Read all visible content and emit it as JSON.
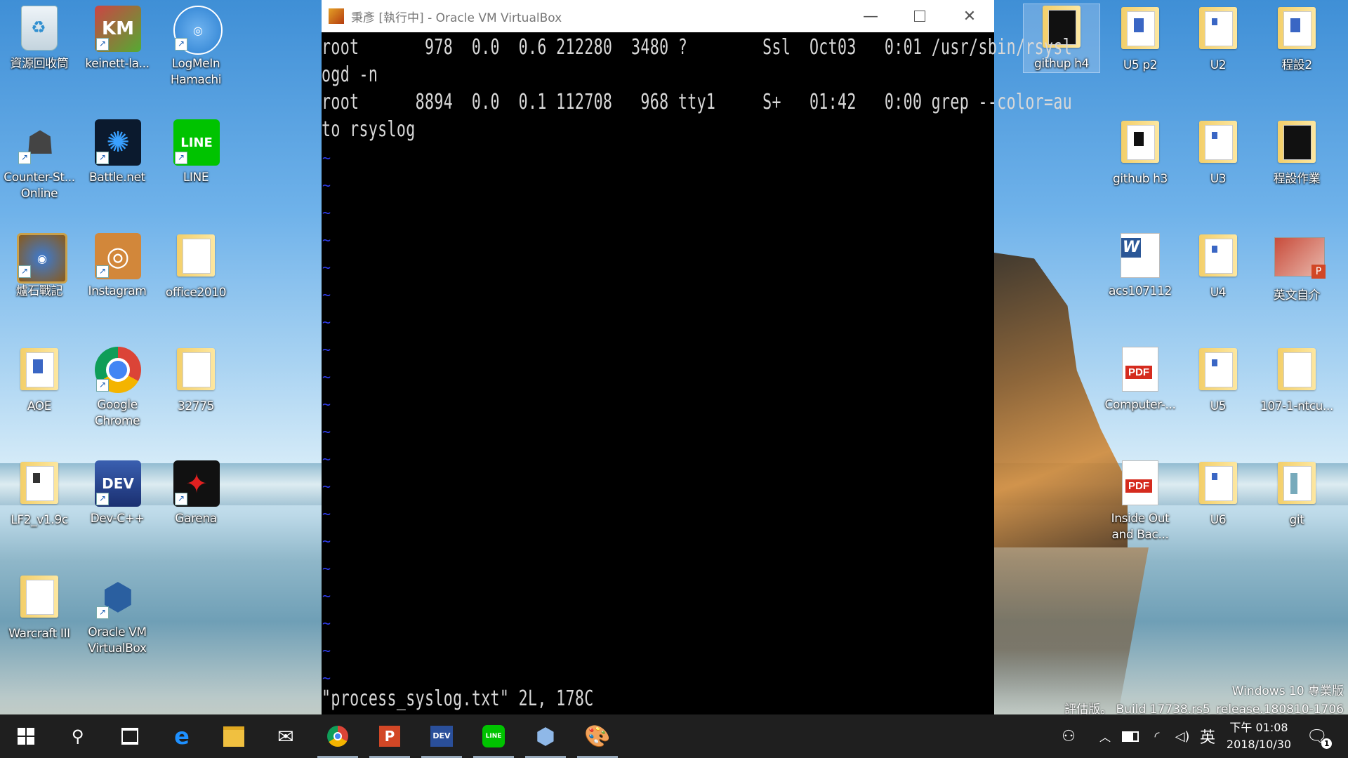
{
  "desktop_icons": [
    {
      "label": "資源回收筒"
    },
    {
      "label": "keinett-la..."
    },
    {
      "label": "LogMeIn Hamachi"
    },
    {
      "label": "Counter-St... Online"
    },
    {
      "label": "Battle.net"
    },
    {
      "label": "LINE"
    },
    {
      "label": "爐石戰記"
    },
    {
      "label": "Instagram"
    },
    {
      "label": "office2010"
    },
    {
      "label": "AOE"
    },
    {
      "label": "Google Chrome"
    },
    {
      "label": "32775"
    },
    {
      "label": "LF2_v1.9c"
    },
    {
      "label": "Dev-C++"
    },
    {
      "label": "Garena"
    },
    {
      "label": "Warcraft III"
    },
    {
      "label": "Oracle VM VirtualBox"
    },
    {
      "label": "githup h4"
    },
    {
      "label": "U5 p2"
    },
    {
      "label": "U2"
    },
    {
      "label": "程設2"
    },
    {
      "label": "github h3"
    },
    {
      "label": "U3"
    },
    {
      "label": "程設作業"
    },
    {
      "label": "acs107112"
    },
    {
      "label": "U4"
    },
    {
      "label": "英文自介"
    },
    {
      "label": "Computer-..."
    },
    {
      "label": "U5"
    },
    {
      "label": "107-1-ntcu..."
    },
    {
      "label": "Inside Out and Bac..."
    },
    {
      "label": "U6"
    },
    {
      "label": "git"
    }
  ],
  "vbox_window": {
    "title": "秉彥 [執行中] - Oracle VM VirtualBox",
    "icons": {
      "minimize": "minimize-icon",
      "maximize": "maximize-icon",
      "close": "close-icon"
    }
  },
  "terminal": {
    "lines": [
      "root       978  0.0  0.6 212280  3480 ?        Ssl  Oct03   0:01 /usr/sbin/rsysl",
      "ogd -n",
      "root      8894  0.0  0.1 112708   968 tty1     S+   01:42   0:00 grep --color=au",
      "to rsyslog"
    ],
    "tilde": "~",
    "status": "\"process_syslog.txt\" 2L, 178C"
  },
  "watermark": {
    "line1": "Windows 10 專業版",
    "line2": "評估版。 Build 17738.rs5_release.180810-1706"
  },
  "taskbar": {
    "apps": [
      "start-icon",
      "search-icon",
      "task-view-icon",
      "edge-icon",
      "file-explorer-icon",
      "mail-icon",
      "chrome-icon",
      "powerpoint-icon",
      "dev-cpp-icon",
      "line-icon",
      "virtualbox-icon",
      "paint-icon"
    ],
    "ime": "英",
    "time": "下午 01:08",
    "date": "2018/10/30",
    "notification_count": "1"
  }
}
